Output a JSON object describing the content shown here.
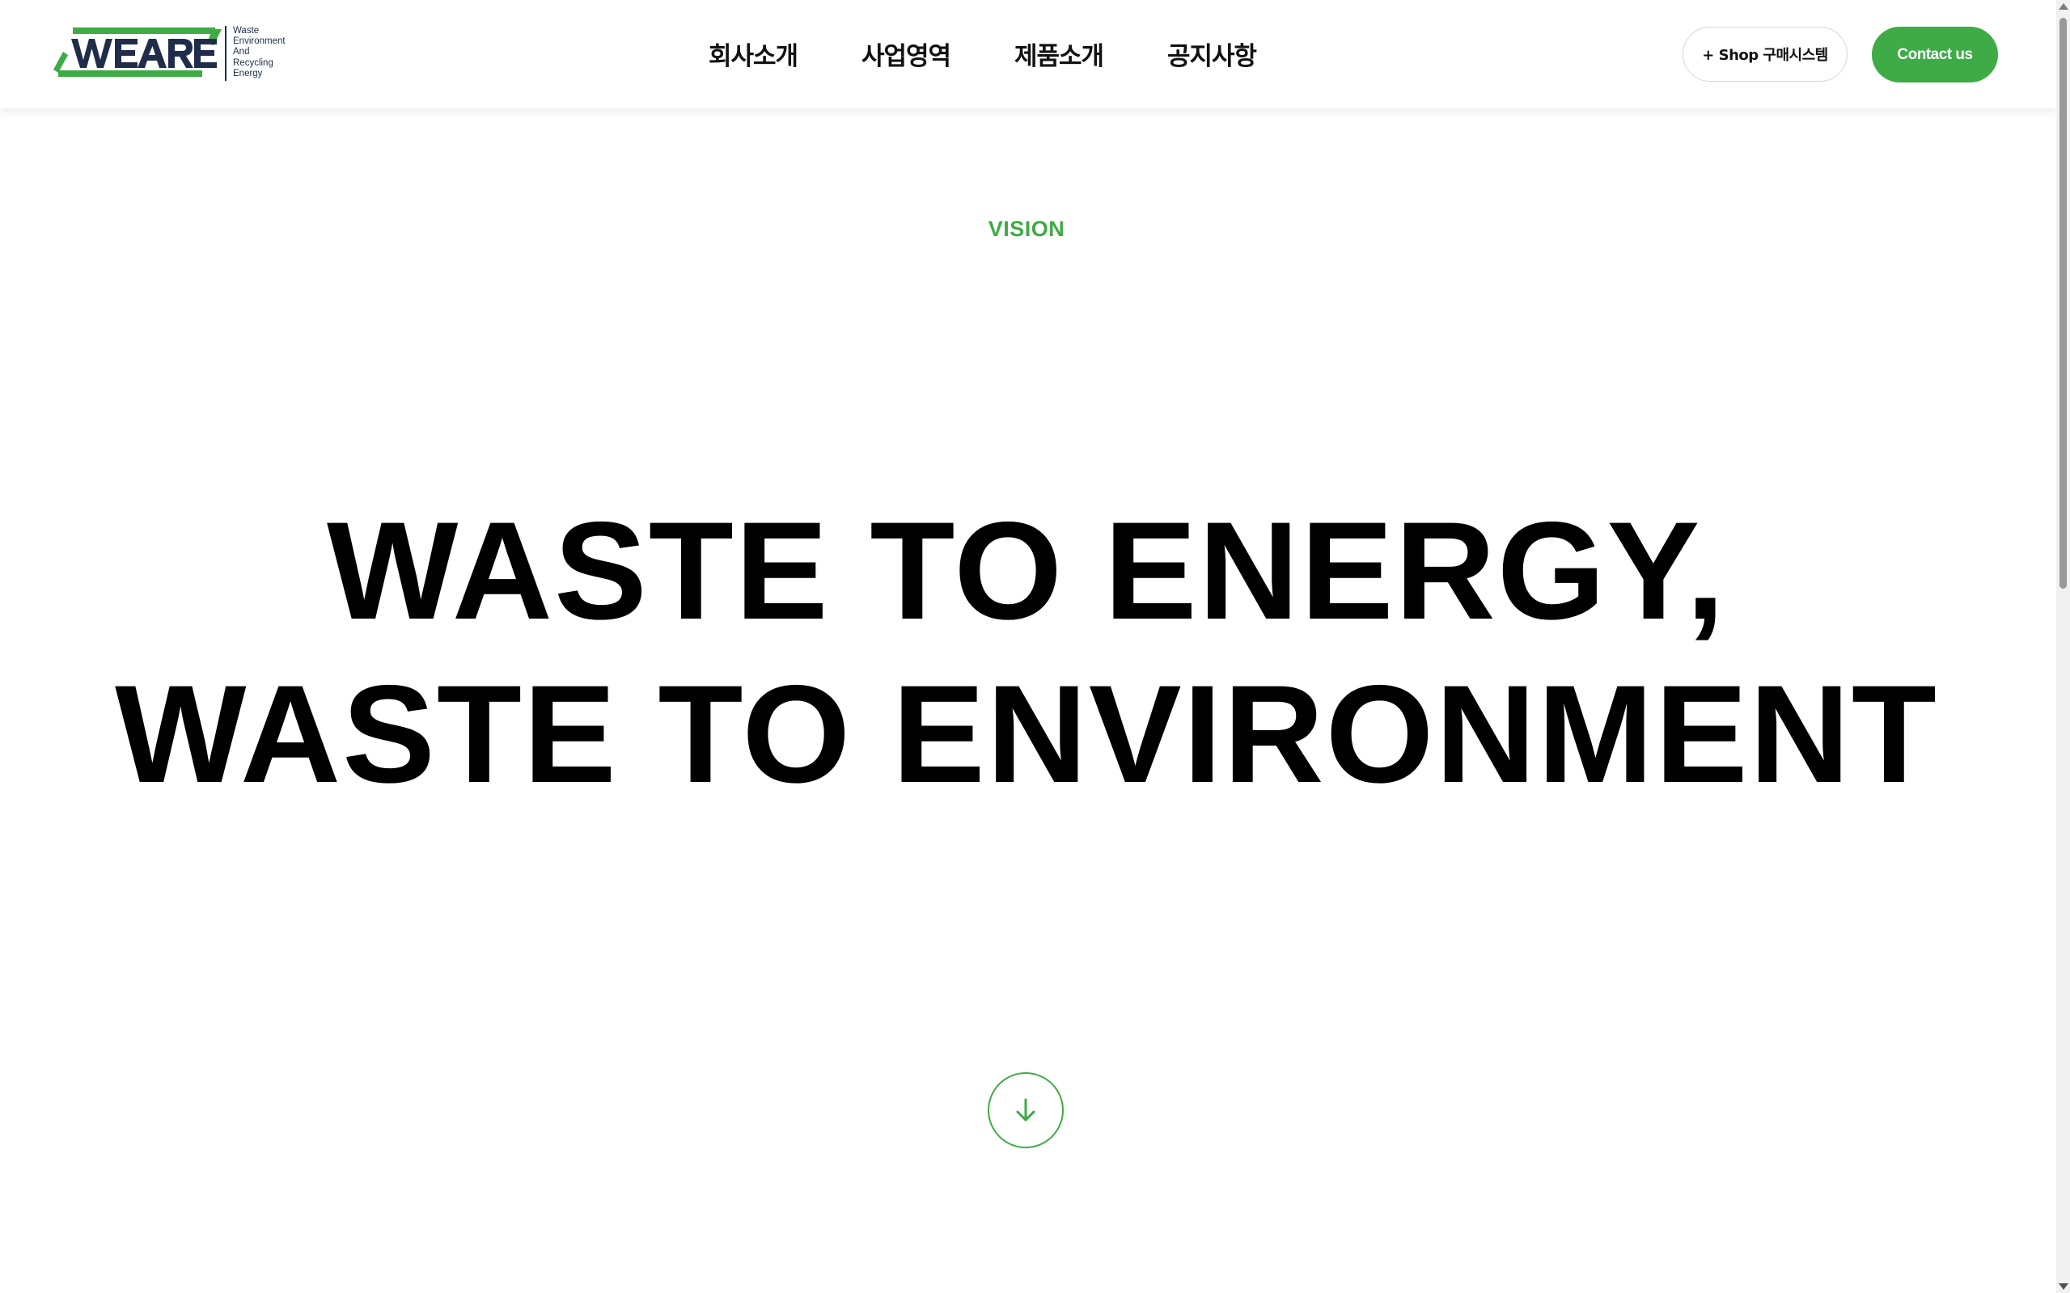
{
  "brand": {
    "logo_wordmark": "WEARE",
    "logo_lines": [
      "Waste",
      "Environment",
      "And",
      "Recycling",
      "Energy"
    ],
    "colors": {
      "green": "#3eab47",
      "navy": "#1f2d4a"
    }
  },
  "nav": {
    "items": [
      {
        "label": "회사소개"
      },
      {
        "label": "사업영역"
      },
      {
        "label": "제품소개"
      },
      {
        "label": "공지사항"
      }
    ]
  },
  "actions": {
    "shop_label": "+ Shop 구매시스템",
    "contact_label": "Contact us"
  },
  "hero": {
    "eyebrow": "VISION",
    "headline_lines": [
      "WASTE TO ENERGY,",
      "WASTE TO ENVIRONMENT"
    ],
    "scroll_icon": "arrow-down-icon"
  },
  "scrollbar": {
    "position_fraction": 0.0
  }
}
